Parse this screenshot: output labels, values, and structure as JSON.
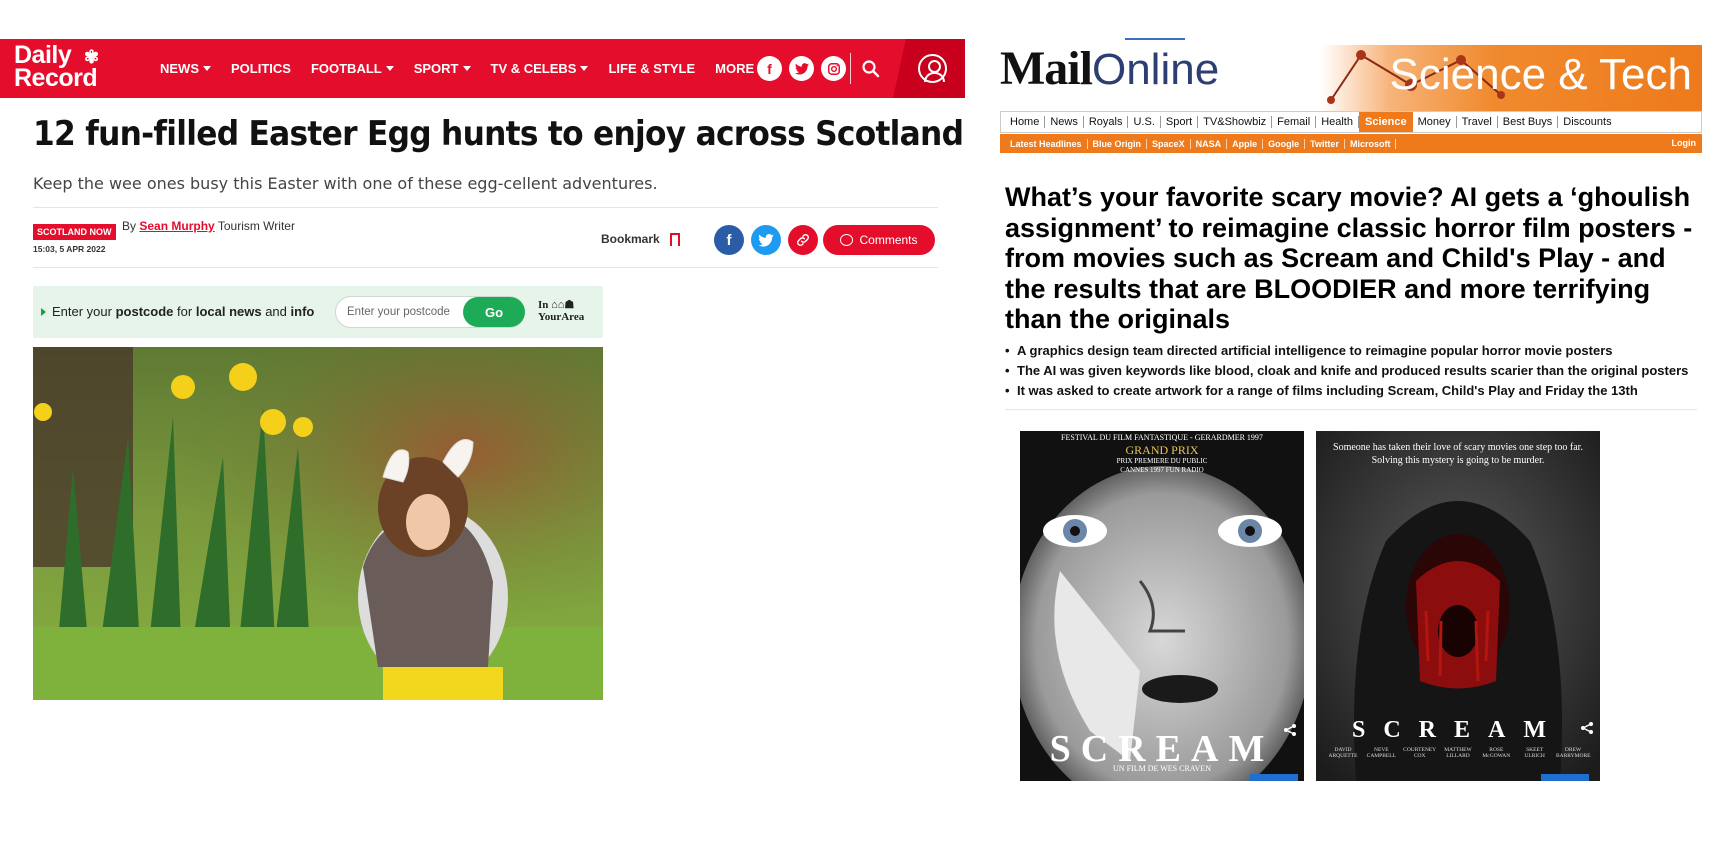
{
  "daily_record": {
    "logo": "Daily Record",
    "nav": [
      "NEWS",
      "POLITICS",
      "FOOTBALL",
      "SPORT",
      "TV & CELEBS",
      "LIFE & STYLE",
      "MORE"
    ],
    "nav_has_caret": [
      true,
      false,
      true,
      true,
      true,
      false,
      true
    ],
    "title": "12 fun-filled Easter Egg hunts to enjoy across Scotland",
    "subtitle": "Keep the wee ones busy this Easter with one of these egg-cellent adventures.",
    "badge": "SCOTLAND NOW",
    "date": "15:03, 5 APR 2022",
    "by": "By",
    "author": "Sean Murphy",
    "role": "Tourism Writer",
    "bookmark": "Bookmark",
    "comments": "Comments",
    "postcode": {
      "prompt_1": "Enter your",
      "prompt_b1": "postcode",
      "prompt_2": "for",
      "prompt_b2": "local news",
      "prompt_3": "and",
      "prompt_b3": "info",
      "placeholder": "Enter your postcode",
      "go": "Go",
      "brand_1": "In",
      "brand_2": "YourArea"
    },
    "colors": {
      "brand": "#e40d2c",
      "facebook": "#2b5ca8",
      "twitter": "#1d9bf0"
    }
  },
  "mail_online": {
    "logo_mail": "Mail",
    "logo_online": "Online",
    "section_banner": "Science & Tech",
    "nav": [
      "Home",
      "News",
      "Royals",
      "U.S.",
      "Sport",
      "TV&Showbiz",
      "Femail",
      "Health",
      "Science",
      "Money",
      "Travel",
      "Best Buys",
      "Discounts"
    ],
    "active_nav": "Science",
    "subnav": [
      "Latest Headlines",
      "Blue Origin",
      "SpaceX",
      "NASA",
      "Apple",
      "Google",
      "Twitter",
      "Microsoft"
    ],
    "login": "Login",
    "headline": "What’s your favorite scary movie? AI gets a ‘ghoulish assignment’ to reimagine classic horror film posters - from movies such as Scream and Child's Play - and the results that are BLOODIER and more terrifying than the originals",
    "bullets": [
      "A graphics design team directed artificial intelligence to reimagine popular horror movie posters",
      "The AI was given keywords like blood, cloak and knife and produced results scarier than the original posters",
      "It was asked to create artwork for a range of films including Scream, Child's Play and Friday the 13th"
    ],
    "poster1": {
      "top_line_1": "FESTIVAL DU FILM FANTASTIQUE - GERARDMER 1997",
      "top_line_2": "GRAND PRIX",
      "top_line_3": "PRIX PREMIERE DU PUBLIC",
      "top_line_4": "CANNES 1997 FUN RADIO",
      "title": "SCREAM",
      "credit": "UN FILM DE WES CRAVEN"
    },
    "poster2": {
      "tagline_1": "Someone has taken their love of scary movies one step too far.",
      "tagline_2": "Solving this mystery is going to be murder.",
      "title": "SCREAM",
      "cast": [
        "DAVID ARQUETTE",
        "NEVE CAMPBELL",
        "COURTENEY COX",
        "MATTHEW LILLARD",
        "ROSE McGOWAN",
        "SKEET ULRICH",
        "DREW BARRYMORE"
      ]
    },
    "colors": {
      "accent": "#ef7a1b"
    }
  }
}
